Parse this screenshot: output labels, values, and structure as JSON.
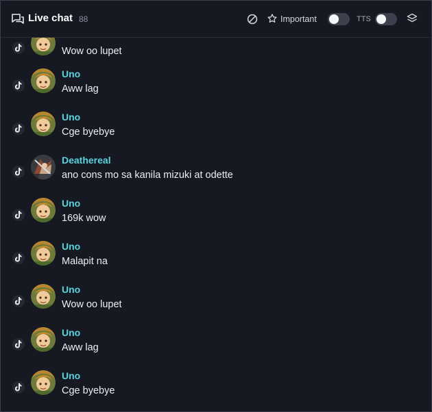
{
  "header": {
    "title": "Live chat",
    "count": "88",
    "important_label": "Important",
    "tts_label": "TTS",
    "important_on": false,
    "tts_on": false
  },
  "messages": [
    {
      "user": "",
      "text": "Wow oo lupet",
      "avatar": "uno",
      "platform": "tiktok-icon"
    },
    {
      "user": "Uno",
      "text": "Aww lag",
      "avatar": "uno",
      "platform": "tiktok-icon"
    },
    {
      "user": "Uno",
      "text": "Cge byebye",
      "avatar": "uno",
      "platform": "tiktok-icon"
    },
    {
      "user": "Deathereal",
      "text": "ano cons mo sa kanila mizuki at odette",
      "avatar": "deathereal",
      "platform": "tiktok-icon"
    },
    {
      "user": "Uno",
      "text": "169k wow",
      "avatar": "uno",
      "platform": "tiktok-icon"
    },
    {
      "user": "Uno",
      "text": "Malapit na",
      "avatar": "uno",
      "platform": "tiktok-icon"
    },
    {
      "user": "Uno",
      "text": "Wow oo lupet",
      "avatar": "uno",
      "platform": "tiktok-icon"
    },
    {
      "user": "Uno",
      "text": "Aww lag",
      "avatar": "uno",
      "platform": "tiktok-icon"
    },
    {
      "user": "Uno",
      "text": "Cge byebye",
      "avatar": "uno",
      "platform": "tiktok-icon"
    }
  ],
  "colors": {
    "background": "#161922",
    "username": "#58d4e0",
    "text": "#eceef2"
  }
}
